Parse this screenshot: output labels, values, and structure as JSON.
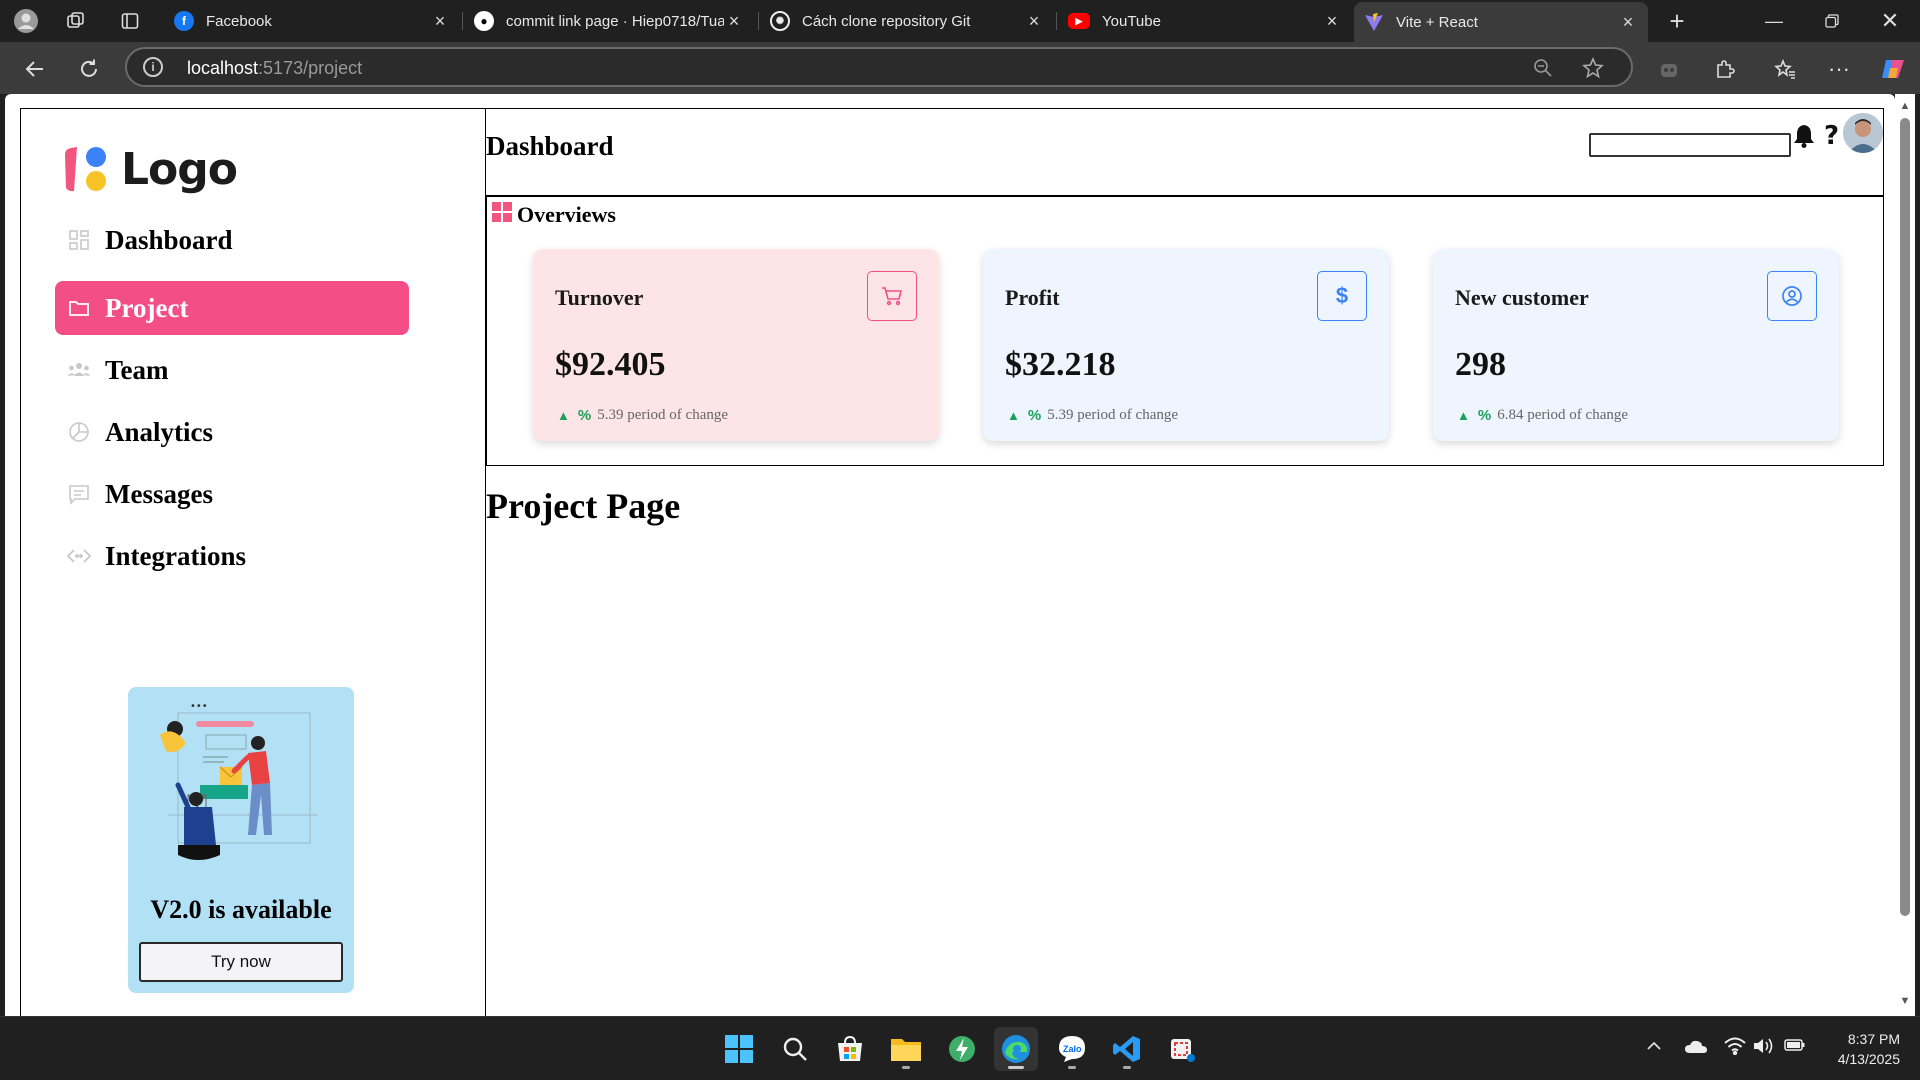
{
  "browser": {
    "tabs": [
      {
        "title": "Facebook",
        "icon": "facebook-icon"
      },
      {
        "title": "commit link page · Hiep0718/Tua",
        "icon": "github-icon"
      },
      {
        "title": "Cách clone repository Git",
        "icon": "chatgpt-icon"
      },
      {
        "title": "YouTube",
        "icon": "youtube-icon"
      },
      {
        "title": "Vite + React",
        "icon": "vite-icon"
      }
    ],
    "url_host": "localhost",
    "url_path": ":5173/project"
  },
  "app": {
    "logo_text": "Logo",
    "nav": [
      {
        "label": "Dashboard",
        "icon": "grid-icon"
      },
      {
        "label": "Project",
        "icon": "folder-icon",
        "active": true
      },
      {
        "label": "Team",
        "icon": "team-icon"
      },
      {
        "label": "Analytics",
        "icon": "pie-chart-icon"
      },
      {
        "label": "Messages",
        "icon": "message-icon"
      },
      {
        "label": "Integrations",
        "icon": "code-icon"
      }
    ],
    "promo": {
      "title": "V2.0 is available",
      "button": "Try now"
    },
    "header": {
      "title": "Dashboard"
    },
    "overview": {
      "title": "Overviews",
      "cards": [
        {
          "title": "Turnover",
          "value": "$92.405",
          "pct_symbol": "%",
          "change": "5.39 period of change",
          "bg": "#fde4e6",
          "accent": "#f44e86",
          "icon": "cart-icon"
        },
        {
          "title": "Profit",
          "value": "$32.218",
          "pct_symbol": "%",
          "change": "5.39 period of change",
          "bg": "#eef5fe",
          "accent": "#3b82f6",
          "icon": "dollar-icon"
        },
        {
          "title": "New customer",
          "value": "298",
          "pct_symbol": "%",
          "change": "6.84 period of change",
          "bg": "#eef5fe",
          "accent": "#3b82f6",
          "icon": "user-circle-icon"
        }
      ]
    },
    "page_title": "Project Page"
  },
  "taskbar": {
    "time": "8:37 PM",
    "date": "4/13/2025"
  }
}
